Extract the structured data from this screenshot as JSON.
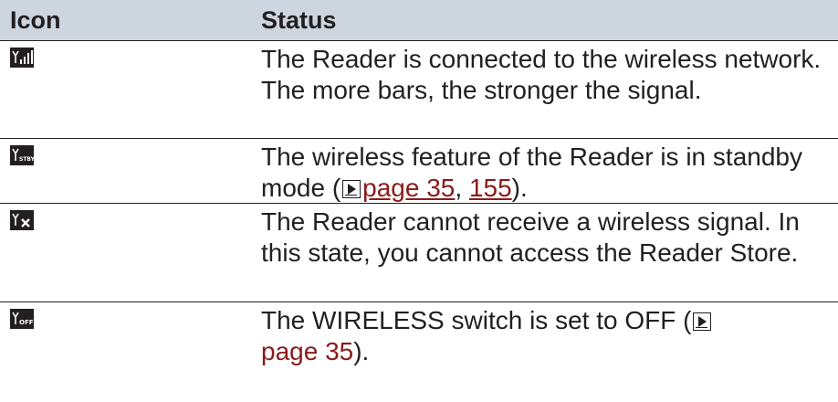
{
  "table": {
    "headers": {
      "icon": "Icon",
      "status": "Status"
    },
    "rows": [
      {
        "icon_name": "wireless-signal-bars-icon",
        "status_text": "The Reader is connected to the wireless network. The more bars, the stronger the signal."
      },
      {
        "icon_name": "wireless-standby-icon",
        "status_before": "The wireless feature of the Reader is in standby mode (",
        "link1": "page 35",
        "separator": ", ",
        "link2": "155",
        "status_after": ")."
      },
      {
        "icon_name": "wireless-no-signal-icon",
        "status_text": "The Reader cannot receive a wireless signal. In this state, you cannot access the Reader Store."
      },
      {
        "icon_name": "wireless-off-icon",
        "status_before": "The WIRELESS switch is set to OFF (",
        "link1": "page 35",
        "status_after": ")."
      }
    ]
  }
}
